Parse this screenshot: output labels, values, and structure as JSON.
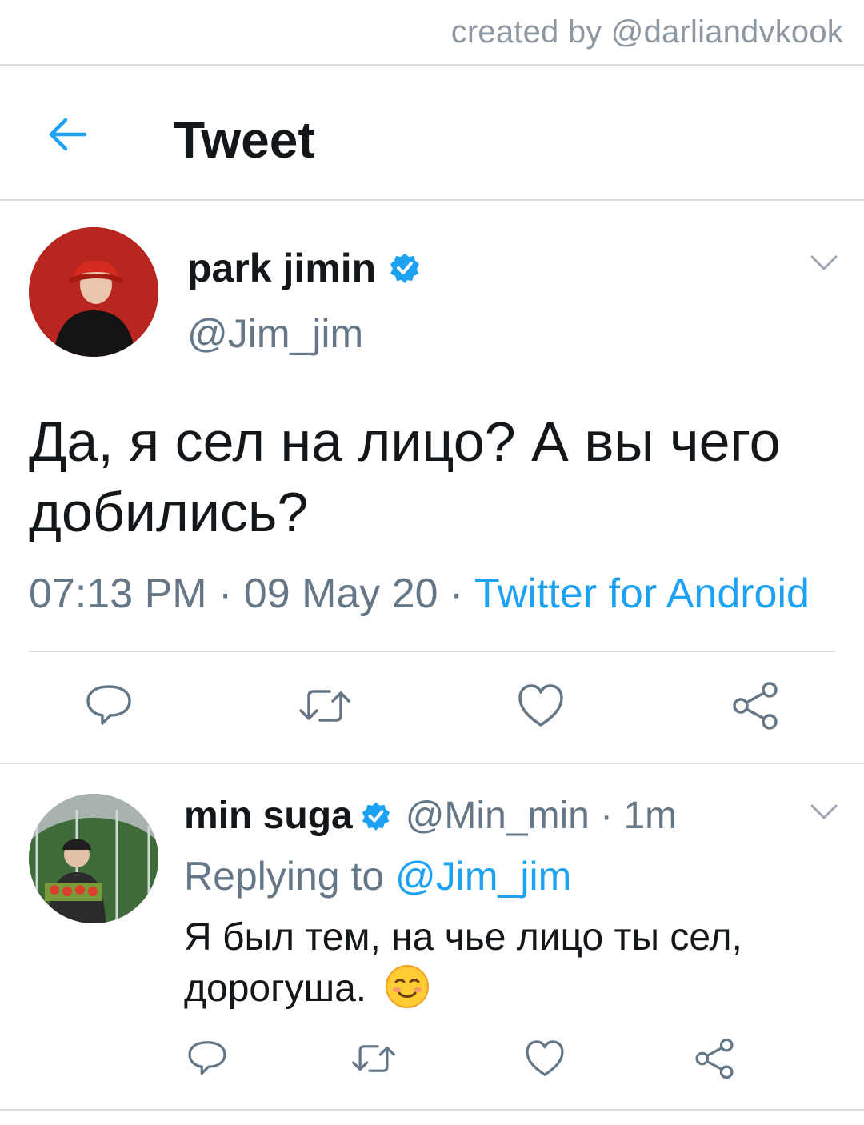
{
  "credit": "created by @darliandvkook",
  "header": {
    "title": "Tweet",
    "back_icon": "arrow-left-icon"
  },
  "colors": {
    "accent": "#1da1f2",
    "secondary_text": "#657786",
    "text": "#14171a",
    "divider": "#d9dee2"
  },
  "main_tweet": {
    "name": "park jimin",
    "handle": "@Jim_jim",
    "text": "Да, я сел на лицо? А вы чего добились?",
    "time": "07:13 PM · 09 May 20 · ",
    "source": "Twitter for Android",
    "verified_icon": "verified-badge-icon"
  },
  "reply": {
    "name": "min suga",
    "handle": "@Min_min · 1m",
    "replying_label": "Replying to ",
    "replying_mention": "@Jim_jim",
    "text": "Я был тем, на чье лицо ты сел, дорогуша.",
    "emoji_icon": "smiling-face-icon"
  },
  "actions": [
    "reply-icon",
    "retweet-icon",
    "like-icon",
    "share-icon"
  ]
}
